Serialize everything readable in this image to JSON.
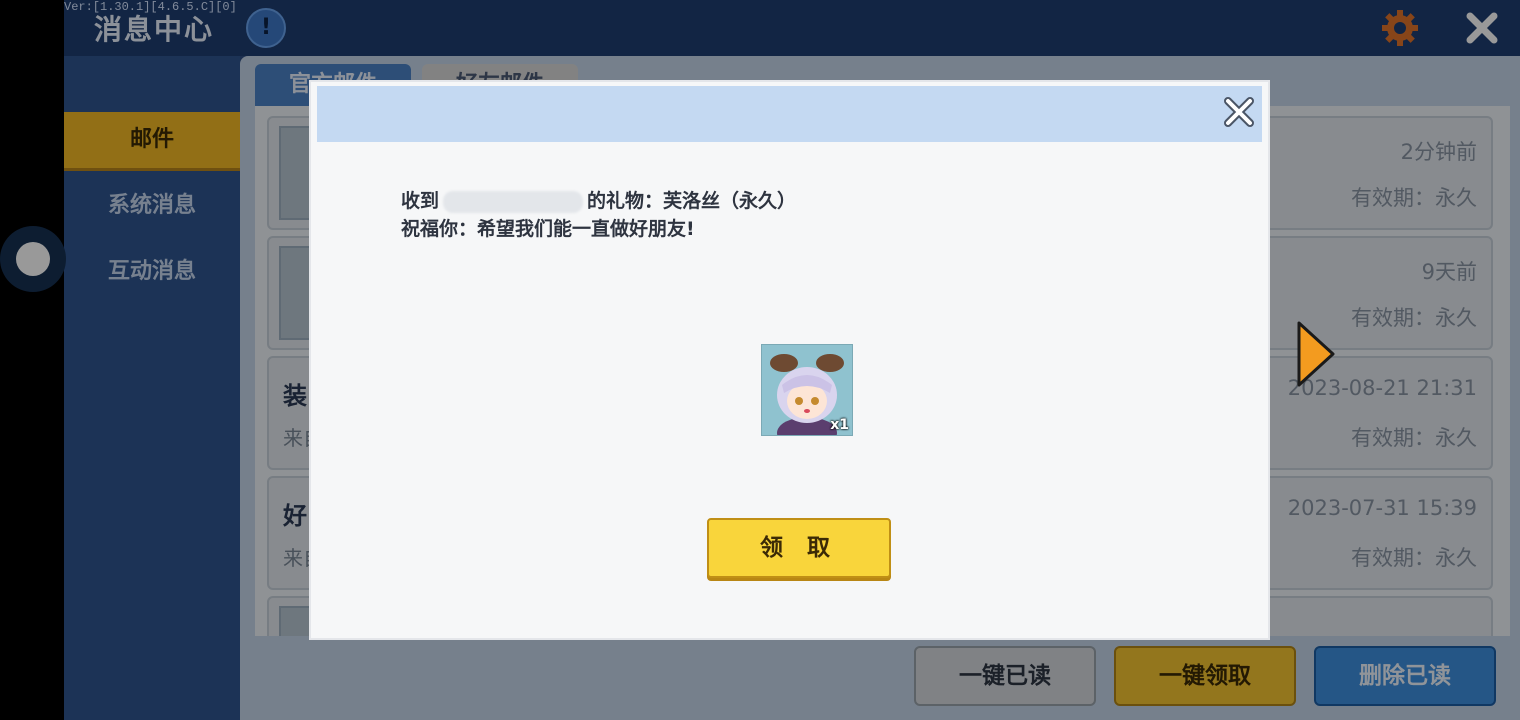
{
  "app": {
    "version": "Ver:[1.30.1][4.6.5.C][0]",
    "title": "消息中心"
  },
  "sidebar": {
    "items": [
      {
        "label": "邮件",
        "active": true
      },
      {
        "label": "系统消息",
        "active": false
      },
      {
        "label": "互动消息",
        "active": false
      }
    ]
  },
  "tabs": [
    {
      "label": "官方邮件",
      "active": true
    },
    {
      "label": "好友邮件",
      "active": false
    }
  ],
  "mail_list": [
    {
      "title": "",
      "sub": "",
      "time": "2分钟前",
      "validity": "有效期：永久"
    },
    {
      "title": "",
      "sub": "",
      "time": "9天前",
      "validity": "有效期：永久"
    },
    {
      "title": "装",
      "sub": "来自",
      "time": "2023-08-21 21:31",
      "validity": "有效期：永久"
    },
    {
      "title": "好",
      "sub": "来自",
      "time": "2023-07-31 15:39",
      "validity": "有效期：永久"
    }
  ],
  "actions": {
    "mark_read": "一键已读",
    "claim_all": "一键领取",
    "delete_read": "删除已读"
  },
  "dialog": {
    "line1_prefix": "收到",
    "line1_suffix": "的礼物：芙洛丝（永久）",
    "line2": "祝福你：希望我们能一直做好朋友!",
    "gift_count": "x1",
    "claim_label": "领 取"
  },
  "colors": {
    "header_bg": "#1f3f72",
    "accent_yellow": "#f6c531",
    "accent_blue": "#3e8fe0",
    "arrow_orange": "#f39b1f",
    "gear_orange": "#e1732a"
  },
  "icons": [
    "info-icon",
    "settings-gear-icon",
    "close-icon",
    "next-arrow-icon",
    "dialog-close-icon"
  ]
}
